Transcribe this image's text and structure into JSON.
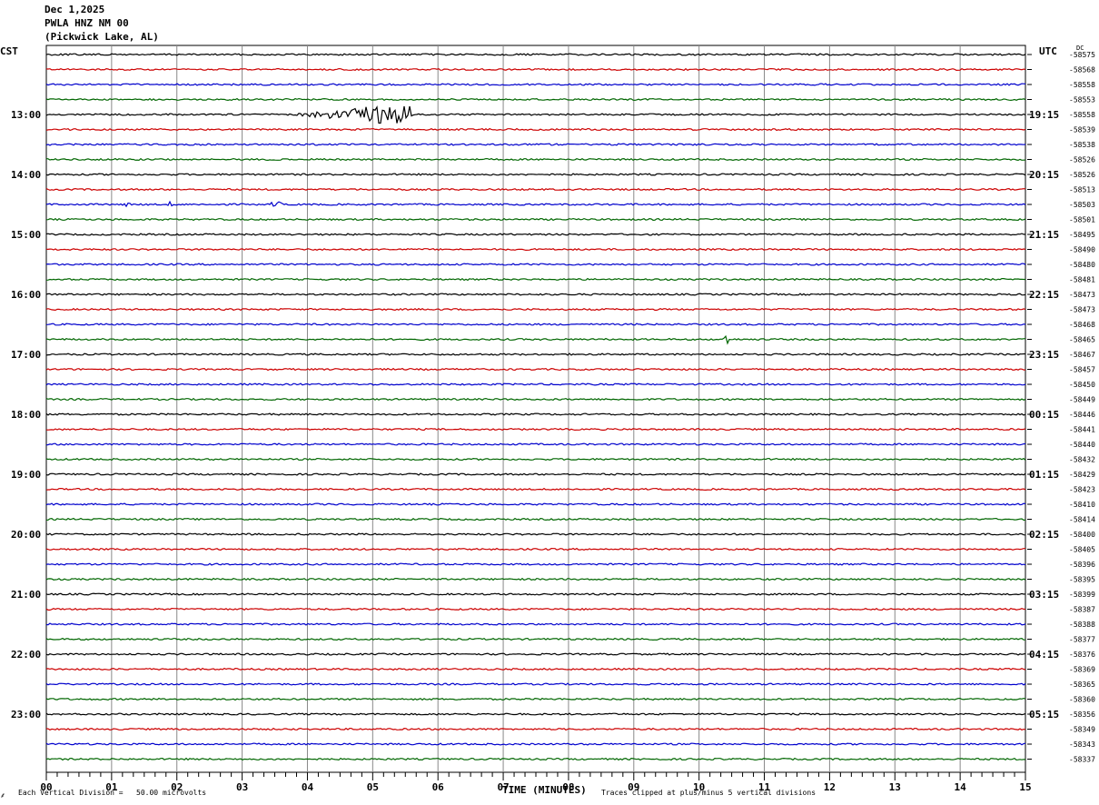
{
  "header": {
    "date": "Dec 1,2025",
    "station": "PWLA HNZ NM 00",
    "location": "(Pickwick Lake, AL)"
  },
  "left_zone": "CST",
  "right_zone": "UTC",
  "dc_label": "DC",
  "xlabel": "TIME (MINUTES)",
  "footer_left": "Each Vertical Division =   50.00 microvolts",
  "footer_right": "Traces clipped at plus/minus 5 vertical divisions",
  "colors": {
    "trace_cycle": [
      "#000000",
      "#cc0000",
      "#0000cc",
      "#006600"
    ],
    "grid": "#888888"
  },
  "chart_data": {
    "type": "line",
    "title": "PWLA HNZ NM 00",
    "xlabel": "TIME (MINUTES)",
    "x_ticks": [
      "00",
      "01",
      "02",
      "03",
      "04",
      "05",
      "06",
      "07",
      "08",
      "09",
      "10",
      "11",
      "12",
      "13",
      "14",
      "15"
    ],
    "xlim": [
      0,
      15
    ],
    "rows_per_hour": 4,
    "left_hour_labels": [
      "13:00",
      "14:00",
      "15:00",
      "16:00",
      "17:00",
      "18:00",
      "19:00",
      "20:00",
      "21:00",
      "22:00",
      "23:00"
    ],
    "right_hour_labels": [
      "19:15",
      "20:15",
      "21:15",
      "22:15",
      "23:15",
      "00:15",
      "01:15",
      "02:15",
      "03:15",
      "04:15",
      "05:15"
    ],
    "dc_offsets": [
      "-58575",
      "-58568",
      "-58558",
      "-58553",
      "-58558",
      "-58539",
      "-58538",
      "-58526",
      "-58526",
      "-58513",
      "-58503",
      "-58501",
      "-58495",
      "-58490",
      "-58480",
      "-58481",
      "-58473",
      "-58473",
      "-58468",
      "-58465",
      "-58467",
      "-58457",
      "-58450",
      "-58449",
      "-58446",
      "-58441",
      "-58440",
      "-58432",
      "-58429",
      "-58423",
      "-58410",
      "-58414",
      "-58400",
      "-58405",
      "-58396",
      "-58395",
      "-58399",
      "-58387",
      "-58388",
      "-58377",
      "-58376",
      "-58369",
      "-58365",
      "-58360",
      "-58356",
      "-58349",
      "-58343",
      "-58337"
    ],
    "events": [
      {
        "row": 4,
        "start_min": 3.8,
        "end_min": 5.6,
        "peak_min": 5.3,
        "amplitude_div": 1.3
      },
      {
        "row": 10,
        "start_min": 1.2,
        "end_min": 1.3,
        "peak_min": 1.25,
        "amplitude_div": 0.6
      },
      {
        "row": 10,
        "start_min": 1.85,
        "end_min": 1.95,
        "peak_min": 1.9,
        "amplitude_div": 0.4
      },
      {
        "row": 10,
        "start_min": 3.45,
        "end_min": 3.6,
        "peak_min": 3.52,
        "amplitude_div": 0.5
      },
      {
        "row": 19,
        "start_min": 10.38,
        "end_min": 10.45,
        "peak_min": 10.42,
        "amplitude_div": 0.9
      }
    ],
    "grid": true
  }
}
